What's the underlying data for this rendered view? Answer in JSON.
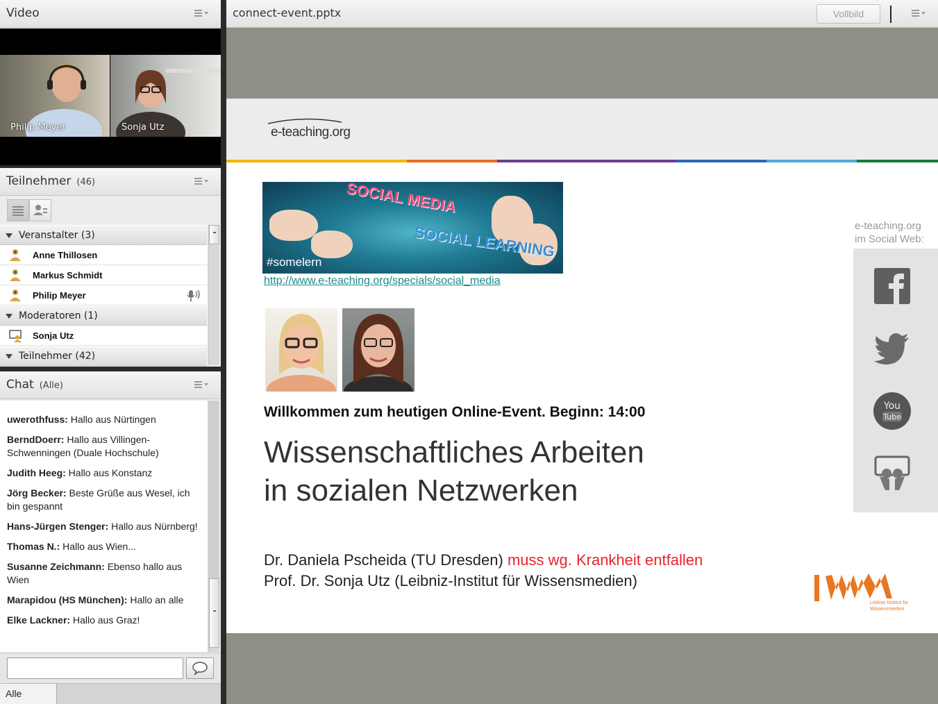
{
  "video": {
    "title": "Video",
    "cams": [
      {
        "name": "Philip Meyer"
      },
      {
        "name": "Sonja Utz"
      }
    ]
  },
  "participants": {
    "title": "Teilnehmer",
    "count": "(46)",
    "groups": [
      {
        "label": "Veranstalter (3)",
        "people": [
          "Anne Thillosen",
          "Markus Schmidt",
          "Philip Meyer"
        ]
      },
      {
        "label": "Moderatoren (1)",
        "people": [
          "Sonja Utz"
        ]
      },
      {
        "label": "Teilnehmer (42)",
        "people": []
      }
    ]
  },
  "chat": {
    "title": "Chat",
    "scope": "(Alle)",
    "messages": [
      {
        "who": "uwerothfuss:",
        "text": " Hallo aus Nürtingen"
      },
      {
        "who": "BerndDoerr:",
        "text": " Hallo aus Villingen-Schwenningen (Duale Hochschule)"
      },
      {
        "who": "Judith Heeg:",
        "text": " Hallo aus Konstanz"
      },
      {
        "who": "Jörg Becker:",
        "text": " Beste Grüße aus Wesel, ich bin gespannt"
      },
      {
        "who": "Hans-Jürgen Stenger:",
        "text": " Hallo aus Nürnberg!"
      },
      {
        "who": "Thomas N.:",
        "text": " Hallo aus Wien..."
      },
      {
        "who": "Susanne Zeichmann:",
        "text": " Ebenso hallo aus Wien"
      },
      {
        "who": "Marapidou (HS München):",
        "text": " Hallo an alle"
      },
      {
        "who": "Elke Lackner:",
        "text": " Hallo aus Graz!"
      }
    ],
    "input_value": "",
    "tab_label": "Alle"
  },
  "share": {
    "title": "connect-event.pptx",
    "fullscreen_label": "Vollbild"
  },
  "slide": {
    "logo": "e-teaching.org",
    "banner_tag": "#somelern",
    "banner_text_1": "SOCIAL MEDIA",
    "banner_text_2": "SOCIAL LEARNING",
    "link": "http://www.e-teaching.org/specials/social_media",
    "welcome": "Willkommen zum heutigen Online-Event. Beginn: 14:00",
    "headline_1": "Wissenschaftliches Arbeiten",
    "headline_2": "in sozialen Netzwerken",
    "speaker_1": "Dr. Daniela Pscheida (TU Dresden)",
    "speaker_1_note": "muss wg. Krankheit entfallen",
    "speaker_2": "Prof. Dr. Sonja Utz (Leibniz-Institut für Wissensmedien)",
    "social_label_1": "e-teaching.org",
    "social_label_2": "im Social Web:",
    "social_icons": [
      "facebook-icon",
      "twitter-icon",
      "youtube-icon",
      "slideshare-icon"
    ],
    "youtube_text_1": "You",
    "youtube_text_2": "Tube",
    "iwm_logo": "IWM",
    "iwm_sub_1": "Leibniz-Institut für",
    "iwm_sub_2": "Wissensmedien",
    "stripe_colors": [
      "#f2b705",
      "#e86f1f",
      "#6b3f8f",
      "#2f67b2",
      "#52a6d8",
      "#1c7a3a",
      "#9bc53d"
    ],
    "accent_red": "#e8232e",
    "iwm_color": "#e87722"
  }
}
